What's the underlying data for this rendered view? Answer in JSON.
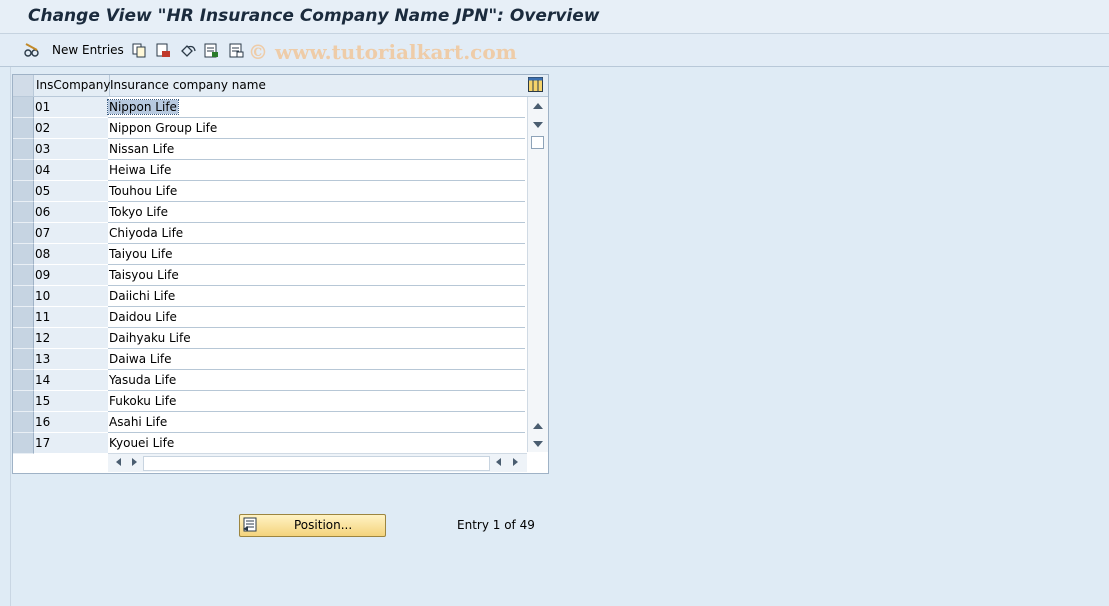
{
  "window": {
    "title": "Change View \"HR Insurance Company Name JPN\": Overview"
  },
  "toolbar": {
    "new_entries_label": "New Entries",
    "icons": [
      "edit-glasses-icon",
      "copy-icon",
      "delete-icon",
      "undo-icon",
      "select-all-icon",
      "deselect-icon"
    ]
  },
  "watermark": "© www.tutorialkart.com",
  "table": {
    "headers": {
      "code": "InsCompany",
      "name": "Insurance company name"
    },
    "rows": [
      {
        "code": "01",
        "name": "Nippon Life"
      },
      {
        "code": "02",
        "name": "Nippon Group Life"
      },
      {
        "code": "03",
        "name": "Nissan Life"
      },
      {
        "code": "04",
        "name": "Heiwa Life"
      },
      {
        "code": "05",
        "name": "Touhou Life"
      },
      {
        "code": "06",
        "name": "Tokyo Life"
      },
      {
        "code": "07",
        "name": "Chiyoda Life"
      },
      {
        "code": "08",
        "name": "Taiyou Life"
      },
      {
        "code": "09",
        "name": "Taisyou Life"
      },
      {
        "code": "10",
        "name": "Daiichi Life"
      },
      {
        "code": "11",
        "name": "Daidou Life"
      },
      {
        "code": "12",
        "name": "Daihyaku Life"
      },
      {
        "code": "13",
        "name": "Daiwa Life"
      },
      {
        "code": "14",
        "name": "Yasuda Life"
      },
      {
        "code": "15",
        "name": "Fukoku Life"
      },
      {
        "code": "16",
        "name": "Asahi Life"
      },
      {
        "code": "17",
        "name": "Kyouei Life"
      }
    ],
    "selected_row": 0
  },
  "footer": {
    "position_button_label": "Position...",
    "entry_info": "Entry 1 of 49"
  },
  "colors": {
    "background": "#dfebf5",
    "button": "#f4d37c",
    "highlight": "#b7c9df"
  }
}
